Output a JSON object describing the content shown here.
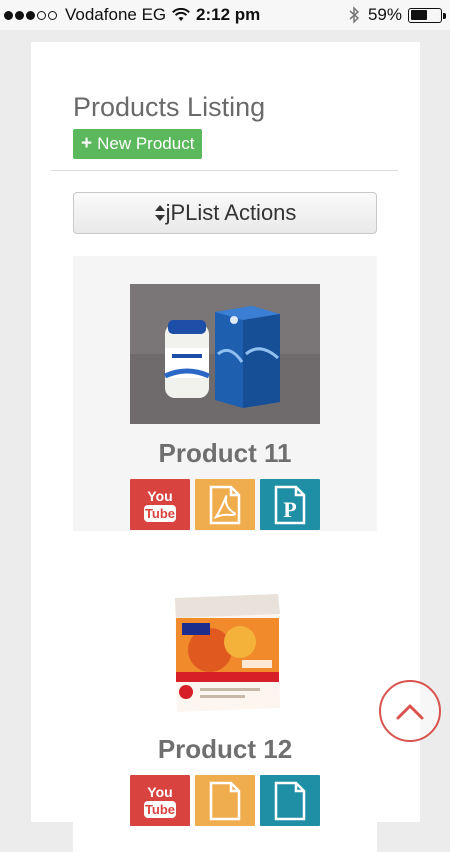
{
  "status_bar": {
    "carrier": "Vodafone EG",
    "time": "2:12 pm",
    "battery_percent": "59%",
    "battery_level": 0.59,
    "signal_bars_filled": 3,
    "signal_bars_total": 5
  },
  "page": {
    "title": "Products Listing",
    "new_product_label": "New Product",
    "actions_label": "jPList Actions"
  },
  "products": [
    {
      "name": "Product 11",
      "image_icon": "supplement-bottle-box-photo"
    },
    {
      "name": "Product 12",
      "image_icon": "vitamin-b12-box-photo"
    }
  ],
  "doc_buttons": {
    "youtube_text_1": "You",
    "youtube_text_2": "Tube",
    "ppt_letter": "P"
  },
  "colors": {
    "success": "#5cb85c",
    "youtube": "#d9433f",
    "pdf": "#f0ad4e",
    "ppt": "#1f8fa5",
    "scroll_top": "#d9534f"
  }
}
